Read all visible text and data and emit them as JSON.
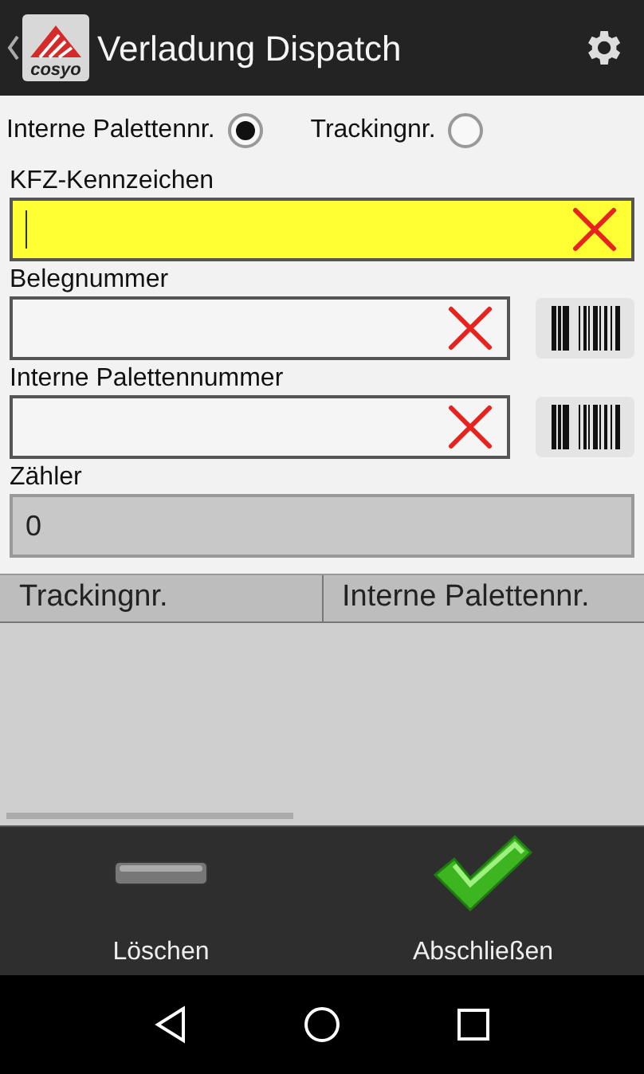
{
  "app_bar": {
    "logo_text": "cosyo",
    "title": "Verladung Dispatch"
  },
  "radio_options": [
    {
      "label": "Interne Palettennr.",
      "selected": true
    },
    {
      "label": "Trackingnr.",
      "selected": false
    }
  ],
  "fields": [
    {
      "label": "KFZ-Kennzeichen",
      "kind": "clearable",
      "focused": true,
      "scan": false
    },
    {
      "label": "Belegnummer",
      "kind": "clearable",
      "focused": false,
      "scan": true
    },
    {
      "label": "Interne Palettennummer",
      "kind": "clearable",
      "focused": false,
      "scan": true
    },
    {
      "label": "Zähler",
      "kind": "readonly",
      "value": "0",
      "focused": false,
      "scan": false
    }
  ],
  "table": {
    "columns": [
      "Trackingnr.",
      "Interne Palettennr."
    ]
  },
  "actions": [
    {
      "kind": "delete",
      "label": "Löschen"
    },
    {
      "kind": "confirm",
      "label": "Abschließen"
    }
  ]
}
